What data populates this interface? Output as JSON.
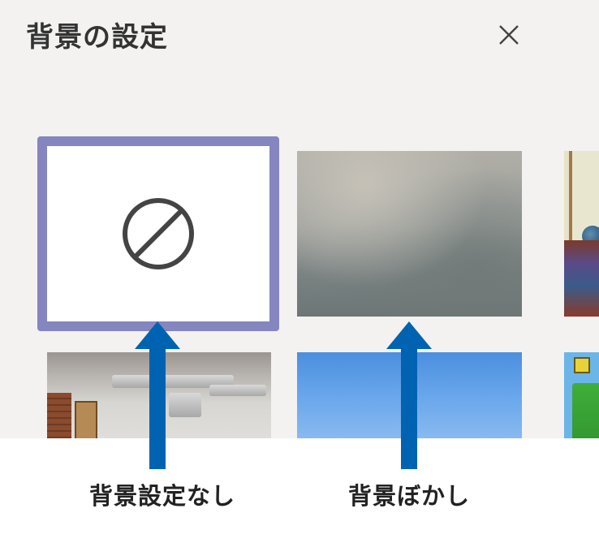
{
  "dialog": {
    "title": "背景の設定",
    "close_icon": "close-icon"
  },
  "tiles": [
    {
      "name": "no-background",
      "selected": true,
      "icon": "no-entry-icon"
    },
    {
      "name": "blur-background",
      "selected": false
    },
    {
      "name": "classroom-background",
      "selected": false
    },
    {
      "name": "loft-office-background",
      "selected": false
    },
    {
      "name": "blue-sky-background",
      "selected": false
    },
    {
      "name": "block-game-background",
      "selected": false
    }
  ],
  "annotations": {
    "arrow_color": "#0063b1",
    "left_caption": "背景設定なし",
    "right_caption": "背景ぼかし"
  },
  "colors": {
    "panel_background": "#f3f2f1",
    "selection_border": "#8585bf"
  }
}
